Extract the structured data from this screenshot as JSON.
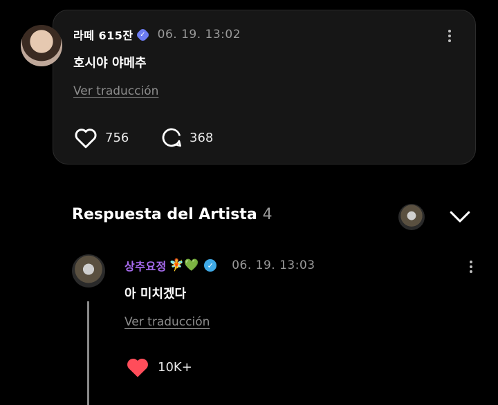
{
  "comment": {
    "username": "라떼 615잔",
    "timestamp": "06. 19. 13:02",
    "text": "호시야 야메추",
    "translate_label": "Ver traducción",
    "likes": "756",
    "replies": "368"
  },
  "artist_section": {
    "title": "Respuesta del Artista",
    "count": "4"
  },
  "reply": {
    "username": "상추요정",
    "emoji": "🧚💚",
    "timestamp": "06. 19. 13:03",
    "text": "아 미치겠다",
    "translate_label": "Ver traducción",
    "likes": "10K+"
  },
  "colors": {
    "background": "#000000",
    "card": "#161616",
    "reply_username": "#a86cf0",
    "heart_liked": "#ff4d5a",
    "verified_comment": "#6c7cf2",
    "verified_reply": "#3fa9e6"
  }
}
